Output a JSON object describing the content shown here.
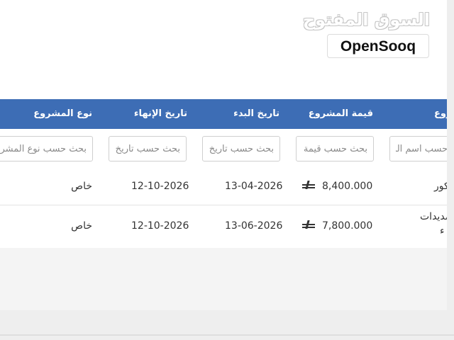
{
  "logo": {
    "arabic": "السوق المفتوح",
    "english": "OpenSooq"
  },
  "table": {
    "headers": {
      "name": "اسم المشروع",
      "value": "قيمة المشروع",
      "start": "تاريخ البدء",
      "end": "تاريخ الإنهاء",
      "type": "نوع المشروع"
    },
    "filters": {
      "name_placeholder": "بحث حسب اسم المشروع",
      "value_placeholder": "بحث حسب قيمة المشروع",
      "start_placeholder": "بحث حسب تاريخ البدء",
      "end_placeholder": "بحث حسب تاريخ الإنهاء",
      "type_placeholder": "بحث حسب نوع المشروع"
    },
    "rows": [
      {
        "name": "ديكور",
        "value": "8,400.000",
        "start": "13-04-2026",
        "end": "12-10-2026",
        "type": "خاص"
      },
      {
        "name": "تمديدات",
        "name_line2": "ء",
        "value": "7,800.000",
        "start": "13-06-2026",
        "end": "12-10-2026",
        "type": "خاص"
      }
    ],
    "currency_icon": "riyal-icon",
    "colors": {
      "header_bg": "#3d6db5",
      "header_text": "#ffffff"
    }
  }
}
